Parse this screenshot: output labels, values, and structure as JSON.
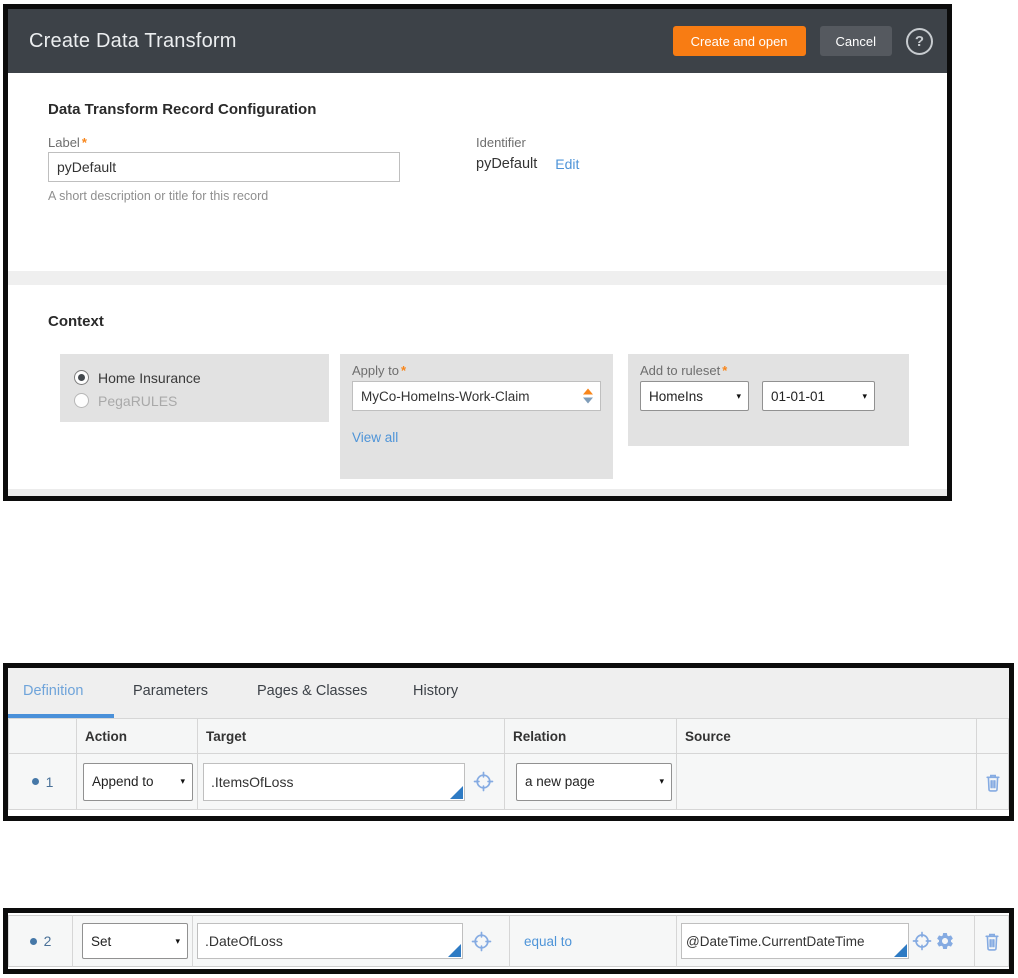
{
  "colors": {
    "header_bg": "#3d4248",
    "primary_button_orange": "#f87c13",
    "cancel_button_gray": "#55595f",
    "link_blue": "#4e94d8",
    "active_tab_blue": "#6fa4da",
    "tab_underline_blue": "#4a90d9",
    "icon_blue": "#85abe2",
    "required_marker_orange": "#f8861b",
    "context_box_gray": "#e2e2e2"
  },
  "icons": {
    "help": "?",
    "dropdown_caret": "▾"
  },
  "dialog": {
    "title": "Create Data Transform",
    "actions": {
      "create": "Create and open",
      "cancel": "Cancel"
    },
    "record_config": {
      "heading": "Data Transform Record Configuration",
      "required_marker": "*",
      "label_field": {
        "label": "Label",
        "value": "pyDefault",
        "helper": "A short description or title for this record"
      },
      "identifier": {
        "label": "Identifier",
        "value": "pyDefault",
        "edit_link": "Edit"
      }
    },
    "context": {
      "heading": "Context",
      "ruleset_options": [
        {
          "label": "Home Insurance",
          "selected": true,
          "disabled": false
        },
        {
          "label": "PegaRULES",
          "selected": false,
          "disabled": true
        }
      ],
      "apply_to": {
        "label": "Apply to",
        "value": "MyCo-HomeIns-Work-Claim",
        "view_all": "View all"
      },
      "add_to_ruleset": {
        "label": "Add to ruleset",
        "ruleset_value": "HomeIns",
        "version_value": "01-01-01"
      }
    }
  },
  "definition_tabs": [
    {
      "label": "Definition",
      "active": true
    },
    {
      "label": "Parameters",
      "active": false
    },
    {
      "label": "Pages & Classes",
      "active": false
    },
    {
      "label": "History",
      "active": false
    }
  ],
  "steps_table": {
    "headers": {
      "action": "Action",
      "target": "Target",
      "relation": "Relation",
      "source": "Source"
    },
    "rows": [
      {
        "number": "1",
        "action": "Append to",
        "target": ".ItemsOfLoss",
        "relation": "a new page",
        "source": ""
      },
      {
        "number": "2",
        "action": "Set",
        "target": ".DateOfLoss",
        "relation": "equal to",
        "source": "@DateTime.CurrentDateTime"
      }
    ]
  }
}
